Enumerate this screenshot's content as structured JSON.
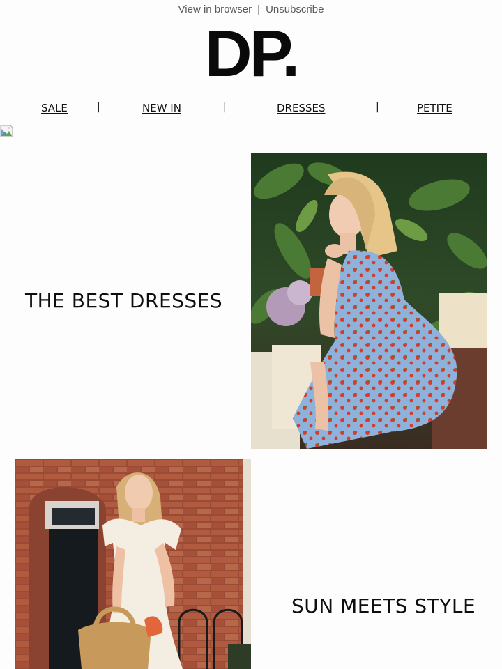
{
  "header": {
    "view_in_browser": "View in browser",
    "separator": "|",
    "unsubscribe": "Unsubscribe"
  },
  "logo": {
    "text": "DP."
  },
  "nav": {
    "items": [
      {
        "label": "SALE"
      },
      {
        "label": "NEW IN"
      },
      {
        "label": "DRESSES"
      },
      {
        "label": "PETITE"
      }
    ],
    "separator": "|"
  },
  "sections": [
    {
      "title": "THE BEST DRESSES",
      "image": {
        "description_icon": "woman-blue-floral-dress-photo"
      }
    },
    {
      "title": "SUN MEETS STYLE",
      "image": {
        "description_icon": "woman-white-dress-brick-wall-photo"
      }
    }
  ],
  "colors": {
    "background": "#fdfdfd",
    "text": "#111111",
    "muted": "#5a5a5a"
  }
}
